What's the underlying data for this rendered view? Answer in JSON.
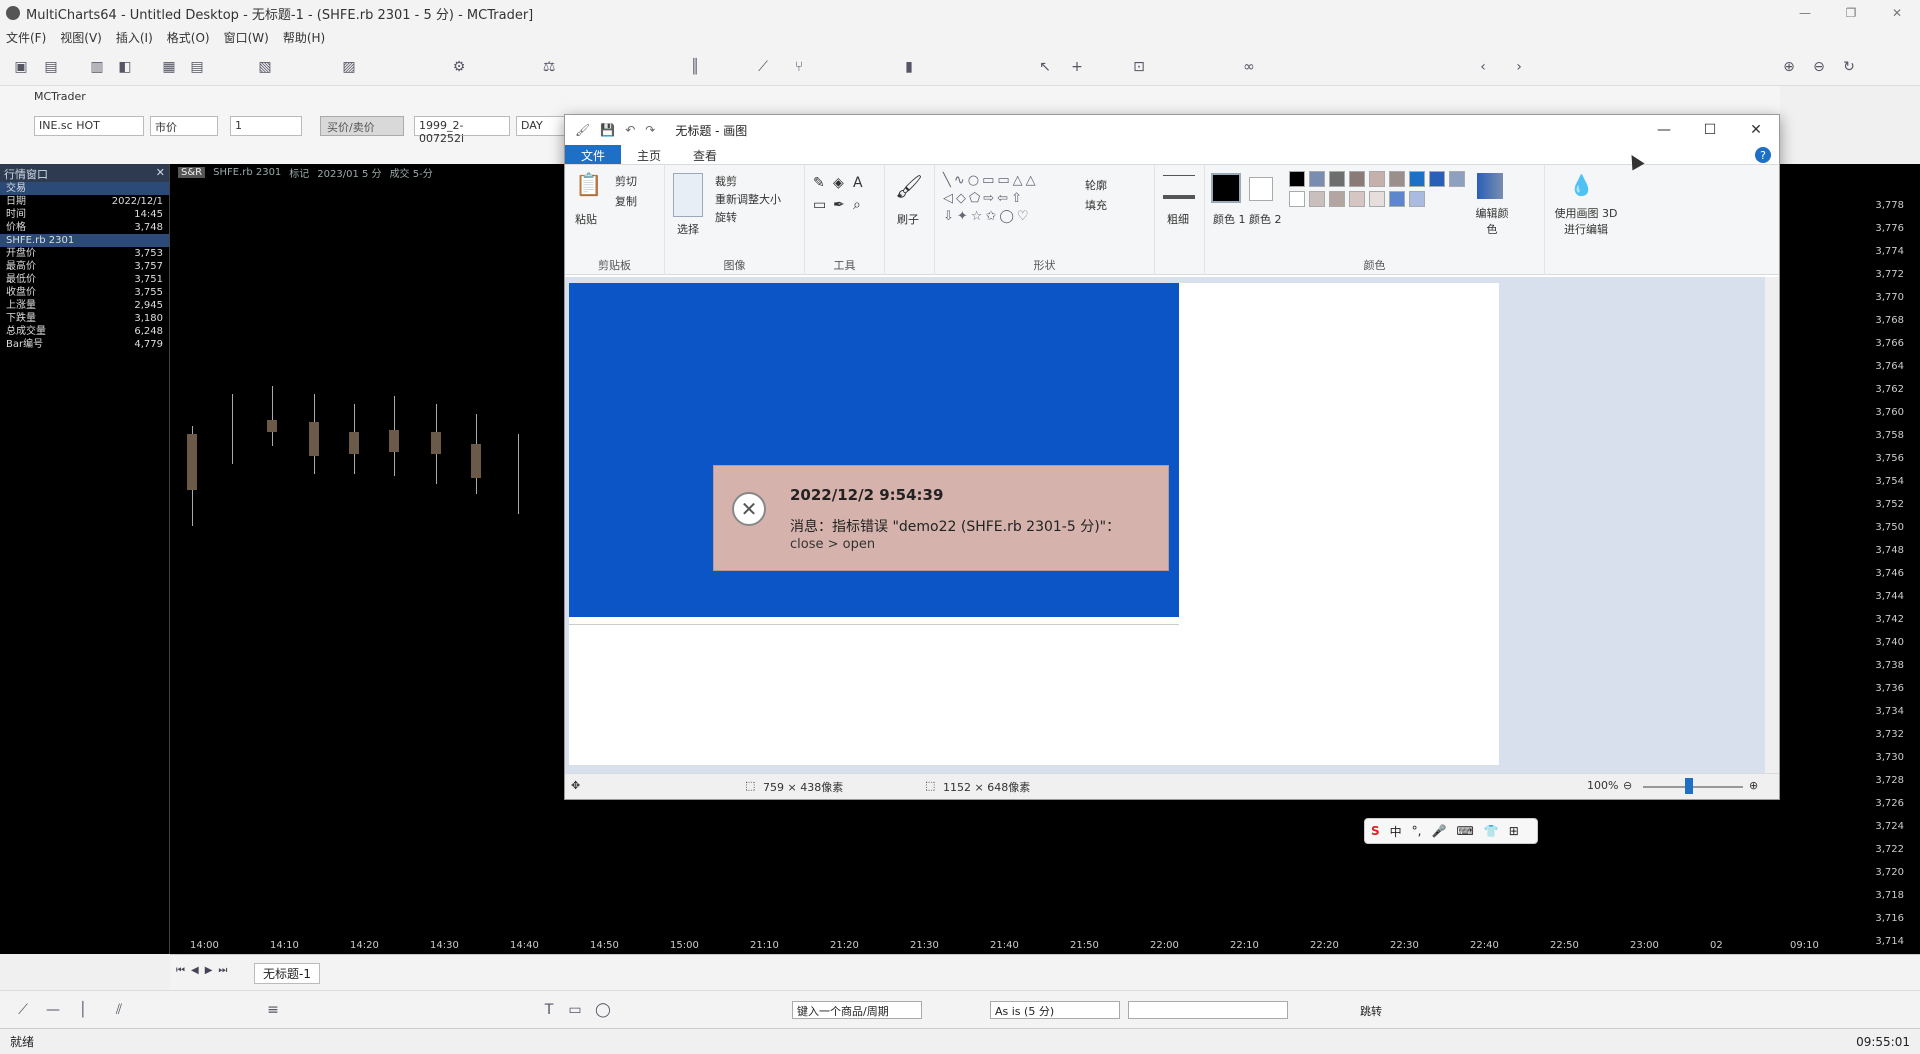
{
  "window": {
    "title": "MultiCharts64 - Untitled Desktop - 无标题-1 - (SHFE.rb 2301 - 5 分) - MCTrader]",
    "controls": [
      "—",
      "❐",
      "✕"
    ]
  },
  "menu": [
    "文件(F)",
    "视图(V)",
    "插入(I)",
    "格式(O)",
    "窗口(W)",
    "帮助(H)"
  ],
  "mctrader": {
    "label": "MCTrader",
    "symbol_value": "INE.sc HOT",
    "order_type": "市价",
    "qty": "1",
    "buy_sell_btn": "买价/卖价",
    "account": "1999_2-007252i",
    "tif": "DAY"
  },
  "left_panel": {
    "header": "行情窗口",
    "rows_top": [
      {
        "label": "交易",
        "value": ""
      },
      {
        "label": "日期",
        "value": "2022/12/1"
      },
      {
        "label": "时间",
        "value": "14:45"
      },
      {
        "label": "价格",
        "value": "3,748"
      }
    ],
    "symbol": "SHFE.rb 2301",
    "rows_bottom": [
      {
        "label": "开盘价",
        "value": "3,753"
      },
      {
        "label": "最高价",
        "value": "3,757"
      },
      {
        "label": "最低价",
        "value": "3,751"
      },
      {
        "label": "收盘价",
        "value": "3,755"
      },
      {
        "label": "上涨量",
        "value": "2,945"
      },
      {
        "label": "下跌量",
        "value": "3,180"
      },
      {
        "label": "总成交量",
        "value": "6,248"
      },
      {
        "label": "Bar编号",
        "value": "4,779"
      }
    ]
  },
  "chart": {
    "header_items": [
      "SHFE.rb 2301",
      "标记",
      "2023/01 5 分",
      "成交 5-分"
    ],
    "price_labels": [
      "3,778",
      "3,776",
      "3,774",
      "3,772",
      "3,770",
      "3,768",
      "3,766",
      "3,764",
      "3,762",
      "3,760",
      "3,758",
      "3,756",
      "3,754",
      "3,752",
      "3,750",
      "3,748",
      "3,746",
      "3,744",
      "3,742",
      "3,740",
      "3,738",
      "3,736",
      "3,734",
      "3,732",
      "3,730",
      "3,728",
      "3,726",
      "3,724",
      "3,722",
      "3,720",
      "3,718",
      "3,716",
      "3,714"
    ],
    "time_labels": [
      "14:00",
      "14:10",
      "14:20",
      "14:30",
      "14:40",
      "14:50",
      "15:00",
      "21:10",
      "21:20",
      "21:30",
      "21:40",
      "21:50",
      "22:00",
      "22:10",
      "22:20",
      "22:30",
      "22:40",
      "22:50",
      "23:00",
      "02",
      "09:10"
    ]
  },
  "paint": {
    "title": "无标题 - 画图",
    "tabs": [
      "文件",
      "主页",
      "查看"
    ],
    "ribbon": {
      "clipboard": {
        "label": "剪贴板",
        "paste": "粘贴",
        "cut": "剪切",
        "copy": "复制"
      },
      "image": {
        "label": "图像",
        "select": "选择",
        "crop": "裁剪",
        "resize": "重新调整大小",
        "rotate": "旋转"
      },
      "tools": {
        "label": "工具"
      },
      "brush": "刷子",
      "shapes": {
        "label": "形状",
        "outline": "轮廓",
        "fill": "填充"
      },
      "size": "粗细",
      "color1": "颜色 1",
      "color2": "颜色 2",
      "colors_label": "颜色",
      "edit_colors": "编辑颜色",
      "paint3d": "使用画图 3D 进行编辑"
    },
    "status": {
      "selection_size": "759 × 438像素",
      "image_size": "1152 × 648像素",
      "zoom": "100%"
    }
  },
  "error_dialog": {
    "timestamp": "2022/12/2 9:54:39",
    "message": "消息：指标错误 \"demo22 (SHFE.rb 2301-5 分)\"：",
    "detail": "close > open"
  },
  "bottom": {
    "tab": "无标题-1",
    "symbol_input_placeholder": "键入一个商品/周期",
    "as_is": "As is (5 分)",
    "jump": "跳转"
  },
  "status": {
    "left": "就绪",
    "clock": "09:55:01"
  },
  "ime": [
    "中",
    "°,",
    "🎤",
    "⌨",
    "👕",
    "⊞"
  ]
}
